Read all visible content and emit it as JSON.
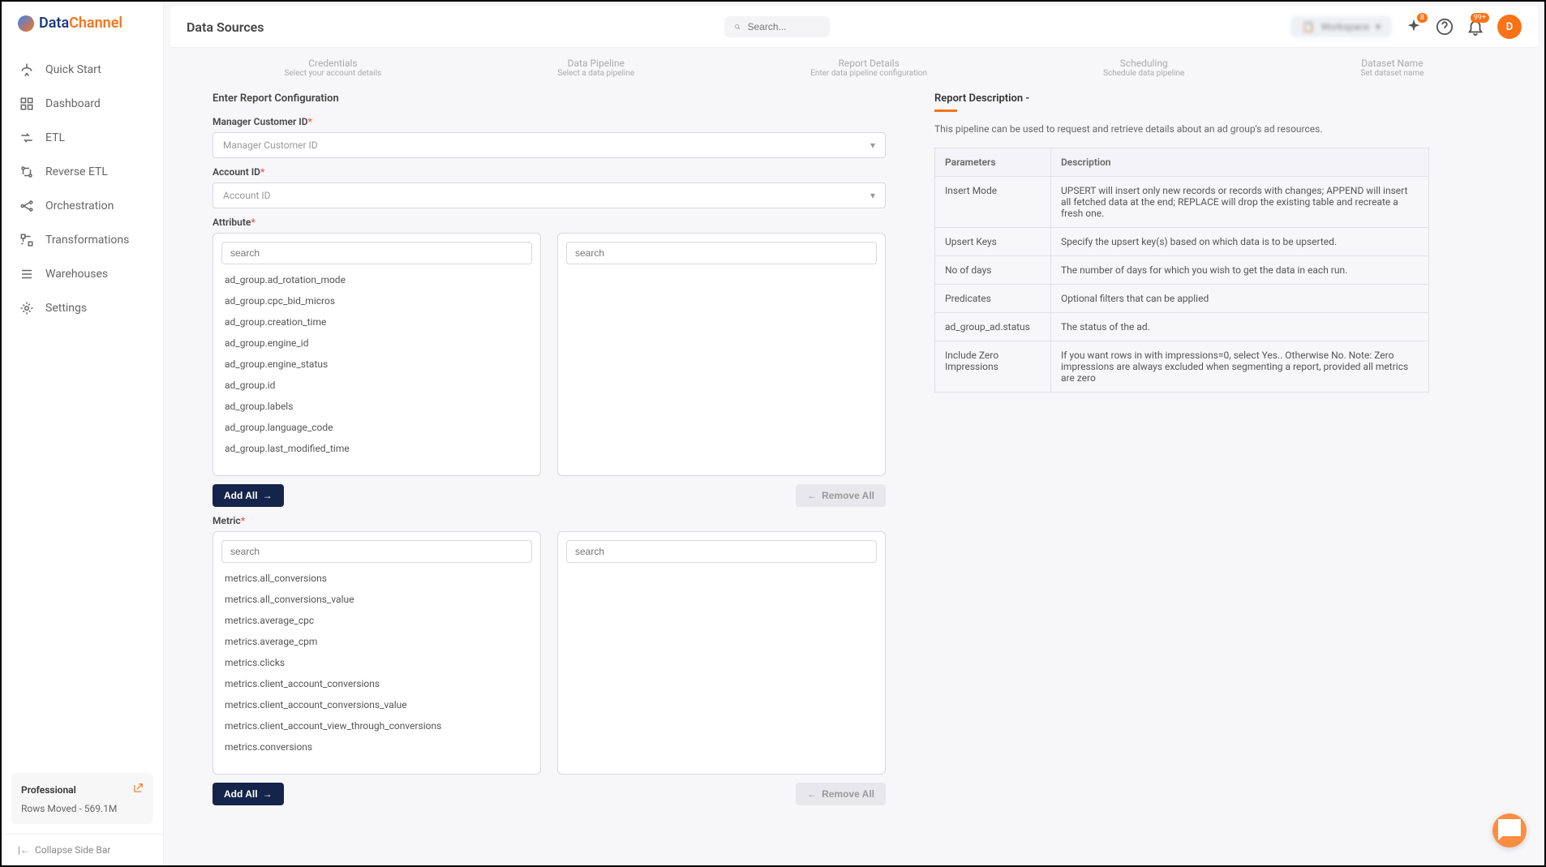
{
  "brand": {
    "data": "Data",
    "channel": "Channel"
  },
  "sidebar": {
    "items": [
      {
        "label": "Quick Start"
      },
      {
        "label": "Dashboard"
      },
      {
        "label": "ETL"
      },
      {
        "label": "Reverse ETL"
      },
      {
        "label": "Orchestration"
      },
      {
        "label": "Transformations"
      },
      {
        "label": "Warehouses"
      },
      {
        "label": "Settings"
      }
    ],
    "plan": {
      "name": "Professional",
      "rows": "Rows Moved - 569.1M"
    },
    "collapse": "Collapse Side Bar"
  },
  "header": {
    "title": "Data Sources",
    "search_placeholder": "Search...",
    "badge_sparkle": "8",
    "badge_bell": "99+",
    "avatar": "D"
  },
  "stepper": [
    {
      "title": "Credentials",
      "sub": "Select your account details"
    },
    {
      "title": "Data Pipeline",
      "sub": "Select a data pipeline"
    },
    {
      "title": "Report Details",
      "sub": "Enter data pipeline configuration"
    },
    {
      "title": "Scheduling",
      "sub": "Schedule data pipeline"
    },
    {
      "title": "Dataset Name",
      "sub": "Set dataset name"
    }
  ],
  "form": {
    "heading": "Enter Report Configuration",
    "manager_label": "Manager Customer ID",
    "manager_placeholder": "Manager Customer ID",
    "account_label": "Account ID",
    "account_placeholder": "Account ID",
    "attribute_label": "Attribute",
    "metric_label": "Metric",
    "search_placeholder": "search",
    "add_all": "Add All",
    "remove_all": "Remove All",
    "attributes": [
      "ad_group.ad_rotation_mode",
      "ad_group.cpc_bid_micros",
      "ad_group.creation_time",
      "ad_group.engine_id",
      "ad_group.engine_status",
      "ad_group.id",
      "ad_group.labels",
      "ad_group.language_code",
      "ad_group.last_modified_time"
    ],
    "metrics": [
      "metrics.all_conversions",
      "metrics.all_conversions_value",
      "metrics.average_cpc",
      "metrics.average_cpm",
      "metrics.clicks",
      "metrics.client_account_conversions",
      "metrics.client_account_conversions_value",
      "metrics.client_account_view_through_conversions",
      "metrics.conversions"
    ]
  },
  "desc": {
    "title": "Report Description -",
    "text": "This pipeline can be used to request and retrieve details about an ad group's ad resources.",
    "th_param": "Parameters",
    "th_desc": "Description",
    "rows": [
      {
        "p": "Insert Mode",
        "d": "UPSERT will insert only new records or records with changes; APPEND will insert all fetched data at the end; REPLACE will drop the existing table and recreate a fresh one."
      },
      {
        "p": "Upsert Keys",
        "d": "Specify the upsert key(s) based on which data is to be upserted."
      },
      {
        "p": "No of days",
        "d": "The number of days for which you wish to get the data in each run."
      },
      {
        "p": "Predicates",
        "d": "Optional filters that can be applied"
      },
      {
        "p": "ad_group_ad.status",
        "d": "The status of the ad."
      },
      {
        "p": "Include Zero Impressions",
        "d": "If you want rows in with impressions=0, select Yes.. Otherwise No. Note: Zero impressions are always excluded when segmenting a report, provided all metrics are zero"
      }
    ]
  }
}
